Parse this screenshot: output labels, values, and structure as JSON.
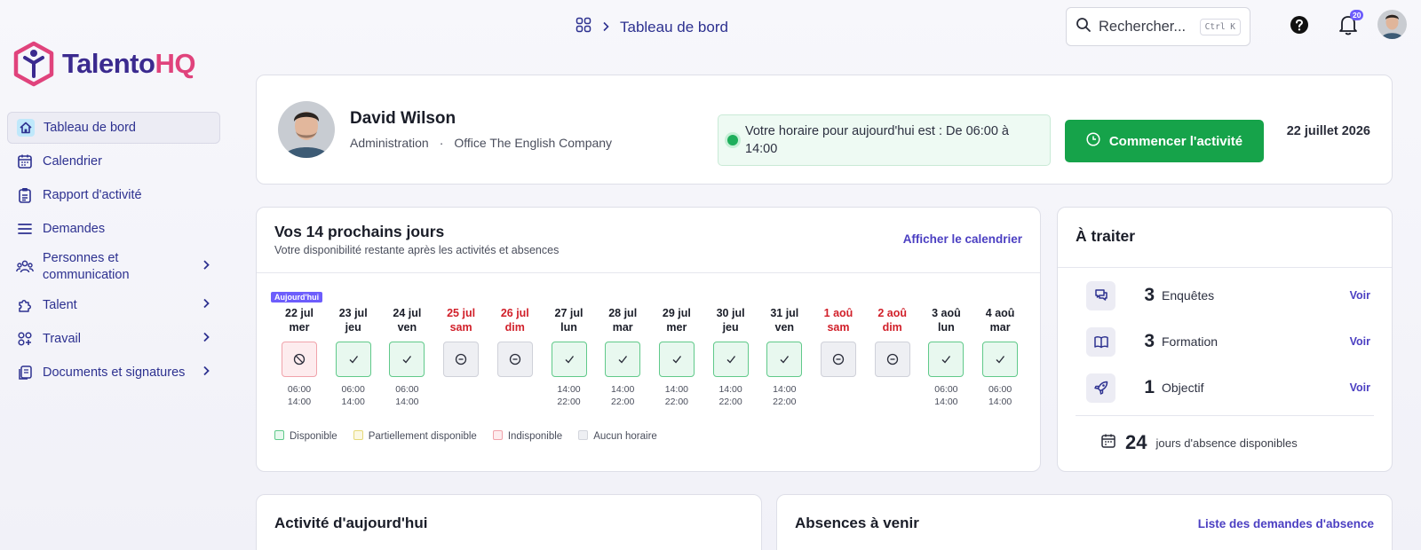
{
  "app": {
    "logo_part1": "Talento",
    "logo_part2": "HQ"
  },
  "sidebar": {
    "items": [
      {
        "label": "Tableau de bord",
        "icon": "home-icon"
      },
      {
        "label": "Calendrier",
        "icon": "calendar-icon"
      },
      {
        "label": "Rapport d'activité",
        "icon": "clipboard-icon"
      },
      {
        "label": "Demandes",
        "icon": "list-icon"
      },
      {
        "label": "Personnes et communication",
        "icon": "people-icon"
      },
      {
        "label": "Talent",
        "icon": "puzzle-icon"
      },
      {
        "label": "Travail",
        "icon": "grid-icon"
      },
      {
        "label": "Documents et signatures",
        "icon": "documents-icon"
      }
    ]
  },
  "header": {
    "breadcrumb": "Tableau de bord",
    "search_placeholder": "Rechercher...",
    "search_shortcut": "Ctrl K",
    "notification_count": "20"
  },
  "profile": {
    "name": "David Wilson",
    "department": "Administration",
    "office": "Office The English Company",
    "separator": "·",
    "schedule_text": "Votre horaire pour aujourd'hui est : De 06:00 à 14:00",
    "start_button": "Commencer l'activité",
    "date": "22 juillet 2026"
  },
  "next14": {
    "title": "Vos 14 prochains jours",
    "subtitle": "Votre disponibilité restante après les activités et absences",
    "link": "Afficher le calendrier",
    "today_tag": "Aujourd'hui",
    "days": [
      {
        "date": "22 jul",
        "dow": "mer",
        "status": "unavailable",
        "start": "06:00",
        "end": "14:00",
        "weekend": false
      },
      {
        "date": "23 jul",
        "dow": "jeu",
        "status": "available",
        "start": "06:00",
        "end": "14:00",
        "weekend": false
      },
      {
        "date": "24 jul",
        "dow": "ven",
        "status": "available",
        "start": "06:00",
        "end": "14:00",
        "weekend": false
      },
      {
        "date": "25 jul",
        "dow": "sam",
        "status": "none",
        "start": "",
        "end": "",
        "weekend": true
      },
      {
        "date": "26 jul",
        "dow": "dim",
        "status": "none",
        "start": "",
        "end": "",
        "weekend": true
      },
      {
        "date": "27 jul",
        "dow": "lun",
        "status": "available",
        "start": "14:00",
        "end": "22:00",
        "weekend": false
      },
      {
        "date": "28 jul",
        "dow": "mar",
        "status": "available",
        "start": "14:00",
        "end": "22:00",
        "weekend": false
      },
      {
        "date": "29 jul",
        "dow": "mer",
        "status": "available",
        "start": "14:00",
        "end": "22:00",
        "weekend": false
      },
      {
        "date": "30 jul",
        "dow": "jeu",
        "status": "available",
        "start": "14:00",
        "end": "22:00",
        "weekend": false
      },
      {
        "date": "31 jul",
        "dow": "ven",
        "status": "available",
        "start": "14:00",
        "end": "22:00",
        "weekend": false
      },
      {
        "date": "1 aoû",
        "dow": "sam",
        "status": "none",
        "start": "",
        "end": "",
        "weekend": true
      },
      {
        "date": "2 aoû",
        "dow": "dim",
        "status": "none",
        "start": "",
        "end": "",
        "weekend": true
      },
      {
        "date": "3 aoû",
        "dow": "lun",
        "status": "available",
        "start": "06:00",
        "end": "14:00",
        "weekend": false
      },
      {
        "date": "4 aoû",
        "dow": "mar",
        "status": "available",
        "start": "06:00",
        "end": "14:00",
        "weekend": false
      }
    ],
    "legend": [
      {
        "label": "Disponible",
        "color": "#60c98a",
        "fill": "#e8f8ef"
      },
      {
        "label": "Partiellement disponible",
        "color": "#e6d97a",
        "fill": "#fbf8e3"
      },
      {
        "label": "Indisponible",
        "color": "#f0a3ab",
        "fill": "#fdecee"
      },
      {
        "label": "Aucun horaire",
        "color": "#d3d5dc",
        "fill": "#eeeff3"
      }
    ]
  },
  "todo": {
    "title": "À traiter",
    "items": [
      {
        "count": "3",
        "label": "Enquêtes",
        "action": "Voir",
        "icon": "chat-icon"
      },
      {
        "count": "3",
        "label": "Formation",
        "action": "Voir",
        "icon": "book-icon"
      },
      {
        "count": "1",
        "label": "Objectif",
        "action": "Voir",
        "icon": "rocket-icon"
      }
    ],
    "absence_days": "24",
    "absence_label": "jours d'absence disponibles"
  },
  "activity": {
    "title": "Activité d'aujourd'hui"
  },
  "absences": {
    "title": "Absences à venir",
    "link": "Liste des demandes d'absence"
  },
  "colors": {
    "accent": "#4b3fc2",
    "brand_primary": "#3b2a8f",
    "brand_secondary": "#e0437c",
    "success": "#16a34a",
    "weekend": "#d1202a"
  }
}
